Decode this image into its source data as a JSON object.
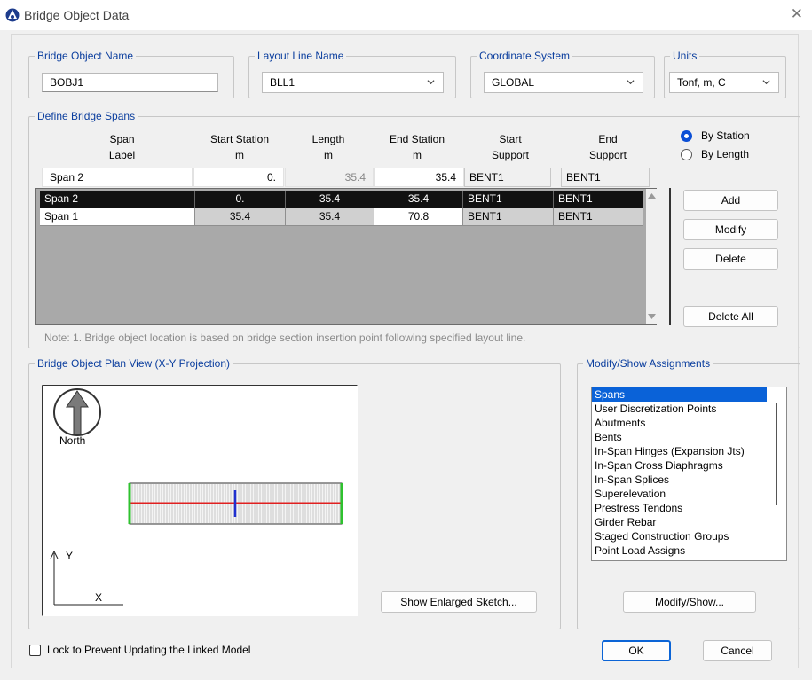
{
  "window": {
    "title": "Bridge Object Data"
  },
  "bridge_object_name": {
    "label": "Bridge Object Name",
    "value": "BOBJ1"
  },
  "layout_line_name": {
    "label": "Layout Line Name",
    "value": "BLL1"
  },
  "coordinate_system": {
    "label": "Coordinate System",
    "value": "GLOBAL"
  },
  "units": {
    "label": "Units",
    "value": "Tonf, m, C"
  },
  "spans": {
    "label": "Define Bridge Spans",
    "headers": [
      [
        "Span",
        "Label"
      ],
      [
        "Start Station",
        "m"
      ],
      [
        "Length",
        "m"
      ],
      [
        "End Station",
        "m"
      ],
      [
        "Start",
        "Support"
      ],
      [
        "End",
        "Support"
      ]
    ],
    "edit_row": [
      "Span 2",
      "0.",
      "35.4",
      "35.4",
      "BENT1",
      "BENT1"
    ],
    "rows": [
      [
        "Span 2",
        "0.",
        "35.4",
        "35.4",
        "BENT1",
        "BENT1"
      ],
      [
        "Span 1",
        "35.4",
        "35.4",
        "70.8",
        "BENT1",
        "BENT1"
      ]
    ],
    "mode_options": [
      "By Station",
      "By Length"
    ],
    "selected_mode": "By Station",
    "buttons": {
      "add": "Add",
      "modify": "Modify",
      "delete": "Delete",
      "delete_all": "Delete All"
    },
    "note": "Note:  1. Bridge object location is based on bridge section insertion point following specified layout line."
  },
  "plan_view": {
    "label": "Bridge Object Plan View (X-Y Projection)",
    "north_label": "North",
    "axis_x": "X",
    "axis_y": "Y",
    "enlarge_button": "Show Enlarged Sketch...",
    "colors": {
      "centerline": "#e02020",
      "abutment": "#2ec22e",
      "bent": "#2030d0",
      "deck": "#999999"
    }
  },
  "assignments": {
    "label": "Modify/Show Assignments",
    "items": [
      "Spans",
      "User Discretization Points",
      "Abutments",
      "Bents",
      "In-Span Hinges (Expansion Jts)",
      "In-Span Cross Diaphragms",
      "In-Span Splices",
      "Superelevation",
      "Prestress Tendons",
      "Girder Rebar",
      "Staged Construction Groups",
      "Point Load Assigns"
    ],
    "selected": "Spans",
    "button": "Modify/Show..."
  },
  "lock_checkbox": {
    "label": "Lock to Prevent Updating the Linked Model",
    "checked": false
  },
  "ok_button": "OK",
  "cancel_button": "Cancel"
}
